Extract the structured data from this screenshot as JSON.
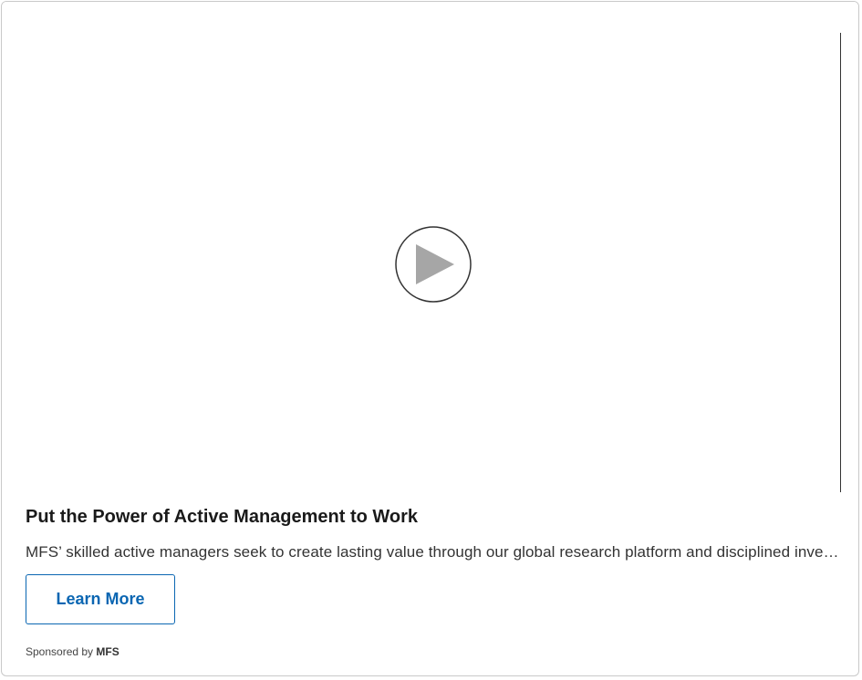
{
  "video": {
    "play_icon": "play-icon"
  },
  "ad": {
    "headline": "Put the Power of Active Management to Work",
    "description": "MFS’ skilled active managers seek to create lasting value through our global research platform and disciplined investment approach.",
    "cta_label": "Learn More",
    "sponsored_prefix": "Sponsored by",
    "sponsor_name": "MFS"
  },
  "colors": {
    "cta": "#0a66b2",
    "play_triangle": "#a6a6a6",
    "play_ring": "#333333"
  }
}
